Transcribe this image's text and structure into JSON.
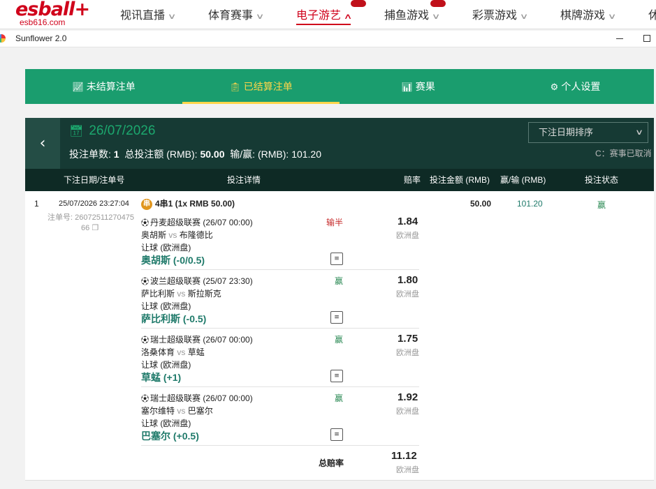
{
  "nav": {
    "logo": "esball+",
    "logo_sub": "esb616.com",
    "items": [
      {
        "label": "视讯直播"
      },
      {
        "label": "体育赛事"
      },
      {
        "label": "电子游艺"
      },
      {
        "label": "捕鱼游戏"
      },
      {
        "label": "彩票游戏"
      },
      {
        "label": "棋牌游戏"
      },
      {
        "label": "休"
      }
    ],
    "active_index": 2
  },
  "window": {
    "title": "Sunflower 2.0"
  },
  "tabs": [
    {
      "label": "未结算注单",
      "icon": "unsettled-bets-icon"
    },
    {
      "label": "已结算注单",
      "icon": "settled-bets-icon"
    },
    {
      "label": "赛果",
      "icon": "results-icon"
    },
    {
      "label": "个人设置",
      "icon": "gear-icon"
    }
  ],
  "active_tab": 1,
  "header": {
    "date": "26/07/2026",
    "bet_count_label": "投注单数:",
    "bet_count": "1",
    "total_stake_label": "总投注额 (RMB):",
    "total_stake": "50.00",
    "win_loss_label": "输/赢: (RMB):",
    "win_loss": "101.20",
    "sort_label": "下注日期排序",
    "note": "C：赛事已取消"
  },
  "columns": [
    "下注日期/注单号",
    "投注详情",
    "赔率",
    "投注金额 (RMB)",
    "赢/输 (RMB)",
    "投注状态"
  ],
  "bet": {
    "index": "1",
    "datetime": "25/07/2026 23:27:04",
    "ticket_label": "注单号:",
    "ticket_no_1": "26072511270475",
    "ticket_no_2": "66",
    "parlay_icon": "串",
    "parlay": "4串1 (1x RMB 50.00)",
    "stake": "50.00",
    "win_loss": "101.20",
    "status": "赢",
    "legs": [
      {
        "league": "丹麦超级联赛 (26/07 00:00)",
        "home": "奥胡斯",
        "vs": "vs",
        "away": "布隆德比",
        "market": "让球 (欧洲盘)",
        "pick": "奥胡斯 (-0/0.5)",
        "result": "输半",
        "odds": "1.84",
        "odds_type": "欧洲盘"
      },
      {
        "league": "波兰超级联赛 (25/07 23:30)",
        "home": "萨比利斯",
        "vs": "vs",
        "away": "斯拉斯克",
        "market": "让球 (欧洲盘)",
        "pick": "萨比利斯 (-0.5)",
        "result": "赢",
        "odds": "1.80",
        "odds_type": "欧洲盘"
      },
      {
        "league": "瑞士超级联赛 (26/07 00:00)",
        "home": "洛桑体育",
        "vs": "vs",
        "away": "草蜢",
        "market": "让球 (欧洲盘)",
        "pick": "草蜢 (+1)",
        "result": "赢",
        "odds": "1.75",
        "odds_type": "欧洲盘"
      },
      {
        "league": "瑞士超级联赛 (26/07 00:00)",
        "home": "塞尔维特",
        "vs": "vs",
        "away": "巴塞尔",
        "market": "让球 (欧洲盘)",
        "pick": "巴塞尔 (+0.5)",
        "result": "赢",
        "odds": "1.92",
        "odds_type": "欧洲盘"
      }
    ],
    "total_odds_label": "总赔率",
    "total_odds": "11.12",
    "total_odds_type": "欧洲盘"
  },
  "colors": {
    "green": "#1a9d6e",
    "dark": "#163a34",
    "accent": "#ffd54a",
    "brand": "#d0021b"
  }
}
